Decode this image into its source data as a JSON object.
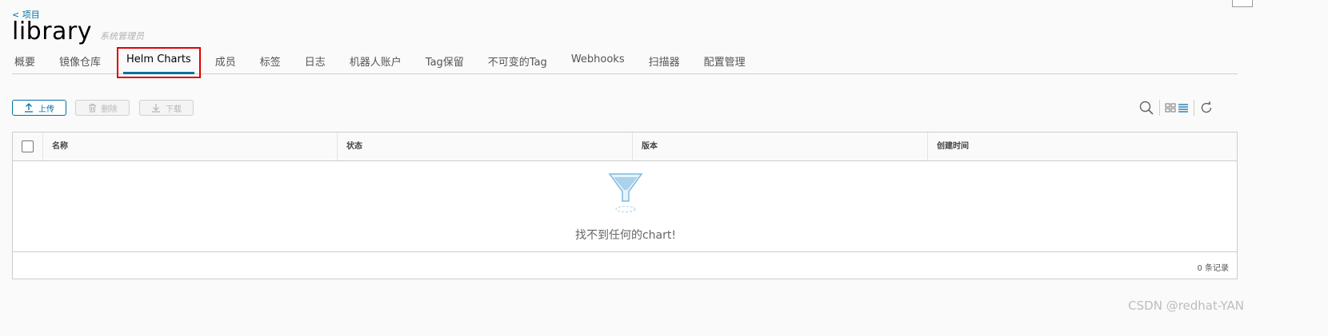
{
  "breadcrumb": {
    "back_label": "< 项目"
  },
  "header": {
    "title": "library",
    "role": "系统管理员"
  },
  "tabs": [
    {
      "label": "概要",
      "active": false
    },
    {
      "label": "镜像仓库",
      "active": false
    },
    {
      "label": "Helm Charts",
      "active": true
    },
    {
      "label": "成员",
      "active": false
    },
    {
      "label": "标签",
      "active": false
    },
    {
      "label": "日志",
      "active": false
    },
    {
      "label": "机器人账户",
      "active": false
    },
    {
      "label": "Tag保留",
      "active": false
    },
    {
      "label": "不可变的Tag",
      "active": false
    },
    {
      "label": "Webhooks",
      "active": false
    },
    {
      "label": "扫描器",
      "active": false
    },
    {
      "label": "配置管理",
      "active": false
    }
  ],
  "toolbar": {
    "upload_label": "上传",
    "delete_label": "删除",
    "download_label": "下载",
    "icons": [
      "search-icon",
      "card-view-icon",
      "list-view-icon",
      "refresh-icon"
    ]
  },
  "grid": {
    "columns": [
      "名称",
      "状态",
      "版本",
      "创建时间"
    ],
    "empty_message": "找不到任何的chart!",
    "footer_count": "0 条记录"
  },
  "watermark": "CSDN @redhat-YAN",
  "colors": {
    "accent": "#0072a3",
    "highlight_box": "#e00000",
    "empty_icon": "#a9d3ec"
  }
}
